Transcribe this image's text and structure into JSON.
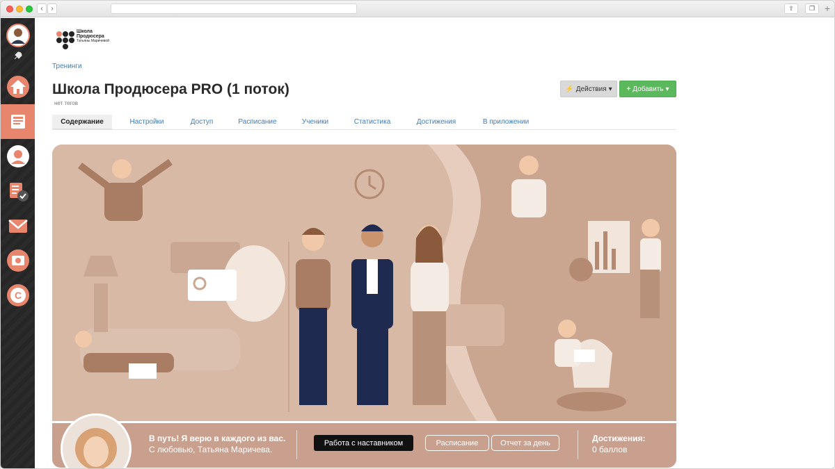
{
  "browser": {
    "back_icon": "chevron-left-icon",
    "forward_icon": "chevron-right-icon",
    "share_icon": "share-icon",
    "tabs_icon": "tabs-icon",
    "new_tab_icon": "plus-icon"
  },
  "sidebar": {
    "items": [
      {
        "icon": "user-avatar-icon",
        "active": false
      },
      {
        "icon": "rocket-icon",
        "active": false
      },
      {
        "icon": "home-icon",
        "active": false
      },
      {
        "icon": "book-icon",
        "active": true
      },
      {
        "icon": "people-icon",
        "active": false
      },
      {
        "icon": "tasks-check-icon",
        "active": false
      },
      {
        "icon": "mail-icon",
        "active": false
      },
      {
        "icon": "camera-icon",
        "active": false
      },
      {
        "icon": "currency-icon",
        "active": false
      }
    ],
    "colors": {
      "bg": "#2b2b2b",
      "active": "#e8866d",
      "icon": "#e8866d"
    }
  },
  "logo": {
    "line1": "Школа",
    "line2": "Продюсера",
    "line3": "Татьяны Маричевой"
  },
  "breadcrumb": "Тренинги",
  "page": {
    "title": "Школа Продюсера PRO (1 поток)",
    "tags": "нет тегов",
    "actions_label": "Действия",
    "add_label": "Добавить"
  },
  "tabs": [
    {
      "label": "Содержание",
      "active": true
    },
    {
      "label": "Настройки",
      "active": false
    },
    {
      "label": "Доступ",
      "active": false
    },
    {
      "label": "Расписание",
      "active": false
    },
    {
      "label": "Ученики",
      "active": false
    },
    {
      "label": "Статистика",
      "active": false
    },
    {
      "label": "Достижения",
      "active": false
    },
    {
      "label": "В приложении",
      "active": false
    }
  ],
  "info_bar": {
    "greeting": "В путь! Я верю в каждого из вас.",
    "signature": "С любовью, Татьяна Маричева.",
    "mentor_button": "Работа с наставником",
    "schedule_button": "Расписание",
    "report_button": "Отчет за день",
    "achievements_title": "Достижения:",
    "achievements_value": "0 баллов"
  },
  "colors": {
    "link": "#3a7cc1",
    "accent_green": "#5cb85c",
    "banner_bg": "#e6cdbd",
    "infobar_bg": "#c9a08e"
  }
}
